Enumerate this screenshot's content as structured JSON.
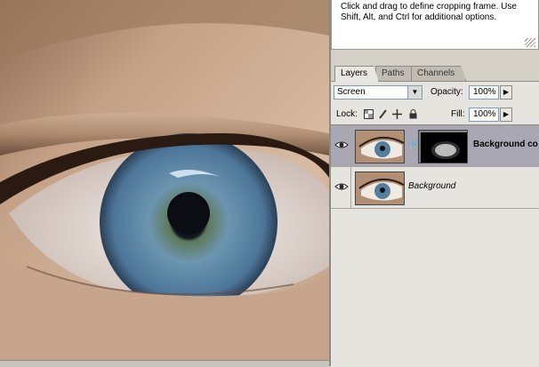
{
  "info": {
    "text": "Click and drag to define cropping frame. Use Shift, Alt, and Ctrl for additional options."
  },
  "tabs": [
    {
      "label": "Layers",
      "active": true
    },
    {
      "label": "Paths",
      "active": false
    },
    {
      "label": "Channels",
      "active": false
    }
  ],
  "layers_panel": {
    "blend_mode": "Screen",
    "opacity_label": "Opacity:",
    "opacity_value": "100%",
    "lock_label": "Lock:",
    "fill_label": "Fill:",
    "fill_value": "100%",
    "lock_icons": [
      "lock-transparent-icon",
      "lock-paint-icon",
      "lock-move-icon",
      "lock-all-icon"
    ]
  },
  "layers": [
    {
      "name": "Background co",
      "visible": true,
      "selected": true,
      "has_mask": true
    },
    {
      "name": "Background",
      "visible": true,
      "selected": false,
      "has_mask": false
    }
  ],
  "colors": {
    "panel_bg": "#d4d0c8",
    "layer_list_bg": "#e6e4de",
    "selected_row": "#a9a7b4",
    "iris": "#4f7fa6",
    "skin": "#c9a689"
  }
}
